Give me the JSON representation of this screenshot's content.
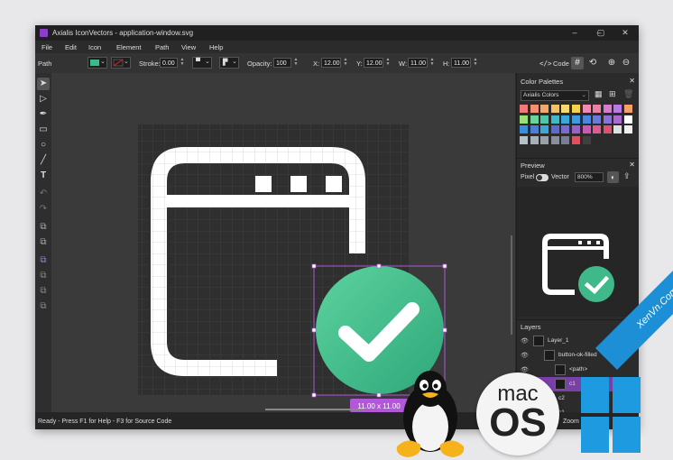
{
  "window": {
    "title": "Axialis IconVectors - application-window.svg",
    "controls": [
      "–",
      "▢",
      "✕"
    ]
  },
  "menu": [
    "File",
    "Edit",
    "Icon",
    "Element",
    "Path",
    "View",
    "Help"
  ],
  "toolbar": {
    "mode_label": "Path",
    "stroke_label": "Stroke:",
    "stroke_value": "0.00",
    "opacity_label": "Opacity:",
    "opacity_value": "100",
    "x_label": "X:",
    "x_value": "12.00",
    "y_label": "Y:",
    "y_value": "12.00",
    "w_label": "W:",
    "w_value": "11.00",
    "h_label": "H:",
    "h_value": "11.00",
    "code_label": "Code",
    "fill_color": "#3fb98a",
    "stroke_color": "#d02020"
  },
  "canvas": {
    "dimension_badge": "11.00 x 11.00",
    "accent": "#b058d8",
    "check_color": "#3fb98a"
  },
  "color_palettes": {
    "title": "Color Palettes",
    "selected": "Axialis Colors",
    "rows": [
      [
        "#f07a7a",
        "#f39070",
        "#f4a76a",
        "#f6c06a",
        "#f6dc6e",
        "#f6d24f",
        "#f08ab0",
        "#ee7fa3",
        "#d77ad0",
        "#b87ae3",
        "#f4a06a"
      ],
      [
        "#9adf7a",
        "#6bd29a",
        "#4cc7a8",
        "#3cbac8",
        "#3aa7d8",
        "#3f9be0",
        "#4a86e0",
        "#6a78e0",
        "#8a72d8",
        "#aa6ad0",
        "#ffffff"
      ],
      [
        "#3a8ee0",
        "#4a7fd8",
        "#3aa7d8",
        "#5a6ad0",
        "#7a6ad0",
        "#9a62c8",
        "#c85ab0",
        "#e05a90",
        "#e05070",
        "#e0e0e0",
        "#f0f0f0"
      ],
      [
        "#b8c0c8",
        "#a8b0b8",
        "#98a0a8",
        "#8890a0",
        "#787f90",
        "#e05060",
        "#404040",
        "#2a2a2a"
      ]
    ]
  },
  "preview": {
    "title": "Preview",
    "pixel_label": "Pixel",
    "vector_label": "Vector",
    "zoom": "800%"
  },
  "layers": {
    "title": "Layers",
    "items": [
      {
        "name": "Layer_1",
        "indent": 0,
        "selected": false
      },
      {
        "name": "button-ok-filled",
        "indent": 1,
        "selected": false
      },
      {
        "name": "<path>",
        "indent": 2,
        "selected": false
      },
      {
        "name": "c1",
        "indent": 2,
        "selected": true
      },
      {
        "name": "c2",
        "indent": 1,
        "selected": false
      },
      {
        "name": "c1",
        "indent": 1,
        "selected": false
      }
    ]
  },
  "status": {
    "text": "Ready - Press F1 for Help - F3 for Source Code",
    "zoom_label": "Zoom"
  },
  "overlay": {
    "mac_line1": "mac",
    "mac_line2": "OS",
    "watermark": "XenVn.Com"
  }
}
